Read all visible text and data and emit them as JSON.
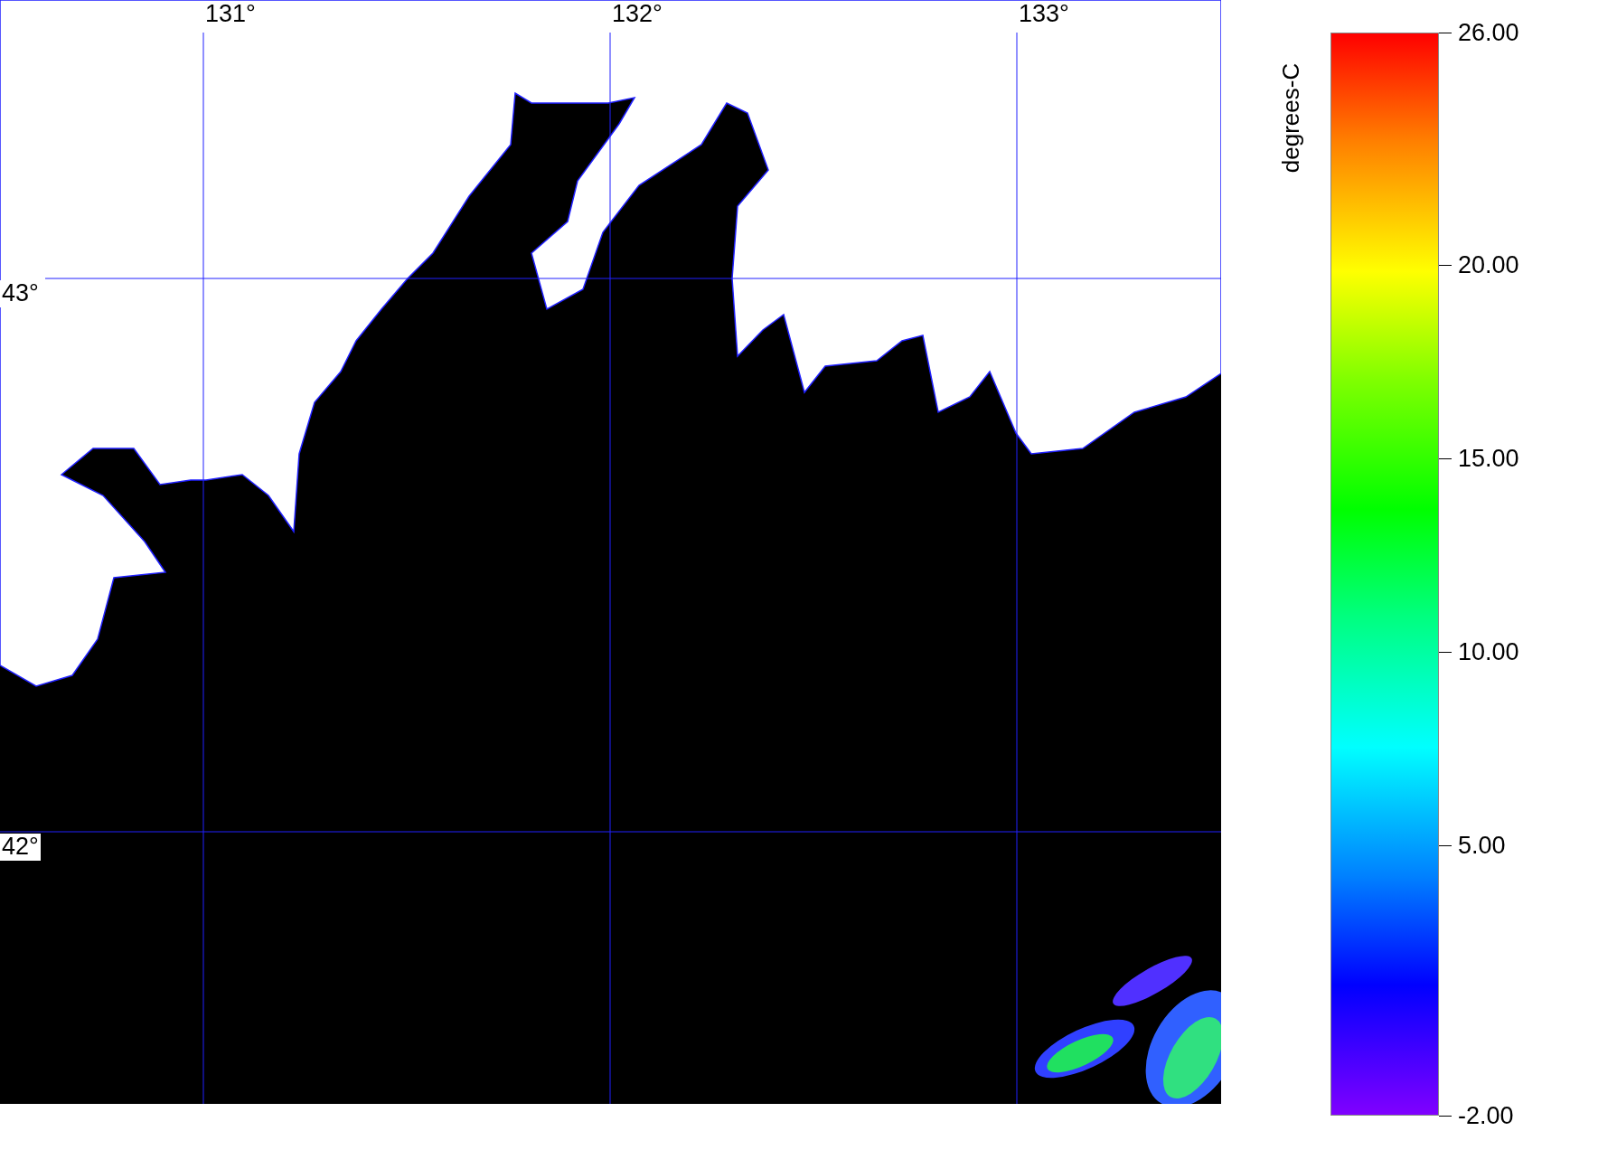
{
  "map": {
    "lon_labels": [
      "131°",
      "132°",
      "133°"
    ],
    "lat_labels": [
      "43°",
      "42°"
    ]
  },
  "colorbar": {
    "label": "degrees-C",
    "ticks": [
      "26.00",
      "20.00",
      "15.00",
      "10.00",
      "5.00",
      "-2.00"
    ]
  }
}
